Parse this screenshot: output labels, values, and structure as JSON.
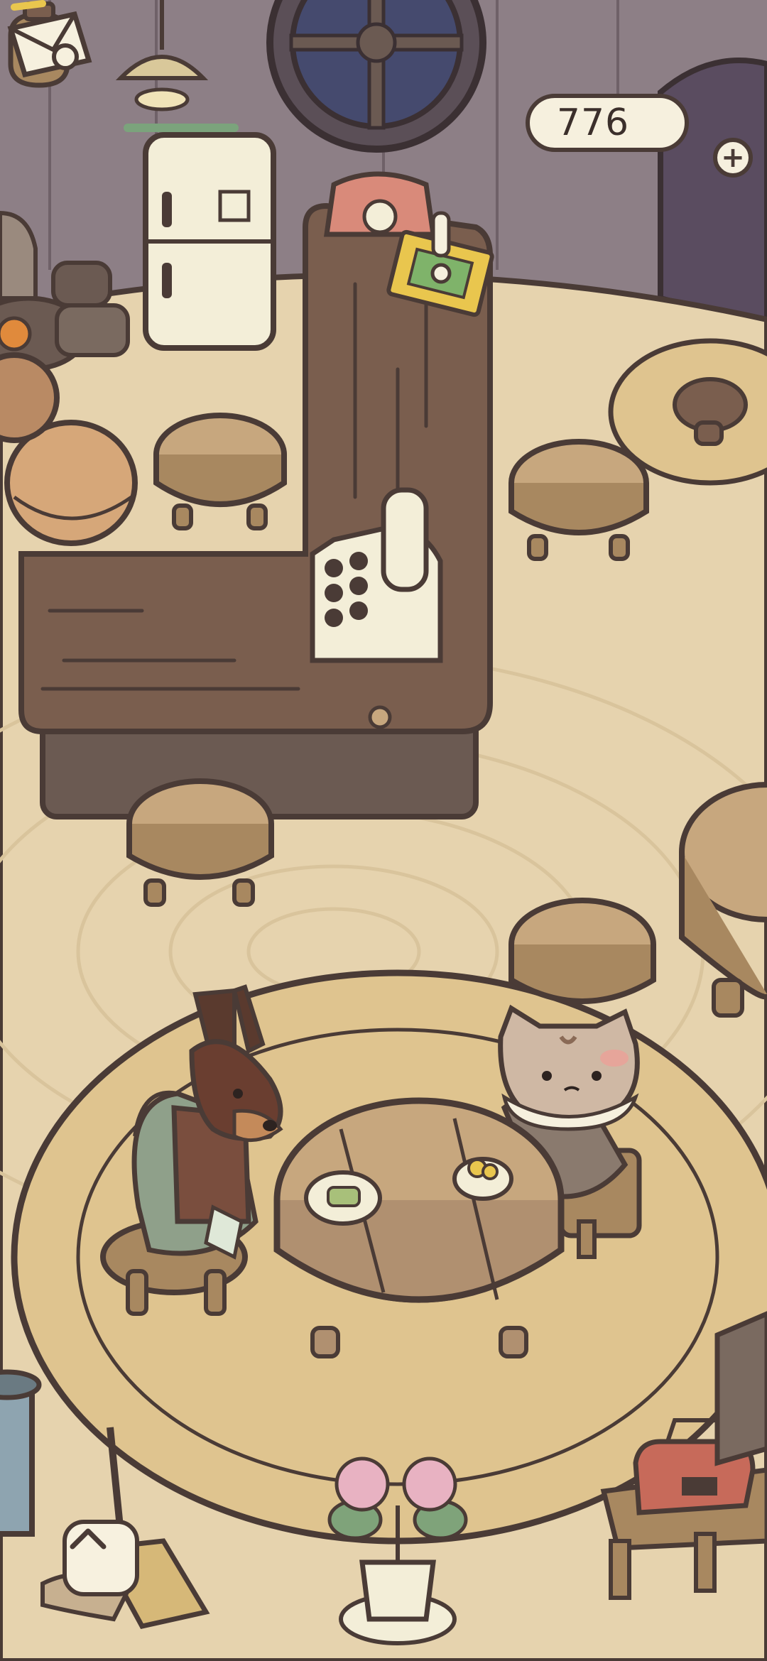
{
  "hud": {
    "coins": "776",
    "add_coins_symbol": "+",
    "mail_icon": "letter-icon",
    "expand_icon": "chevron-up-icon"
  },
  "colors": {
    "floor": "#e6d3ae",
    "wall": "#8d7f86",
    "rug": "#dfc48f",
    "wood_dark": "#7a5e4e",
    "outline": "#4a3b36",
    "cream": "#f6f0de"
  },
  "characters": [
    {
      "kind": "doberman-customer",
      "state": "sitting"
    },
    {
      "kind": "cat-customer",
      "state": "sitting"
    }
  ],
  "notifications": [
    {
      "icon": "exclamation-icon",
      "on": "order-board"
    }
  ]
}
